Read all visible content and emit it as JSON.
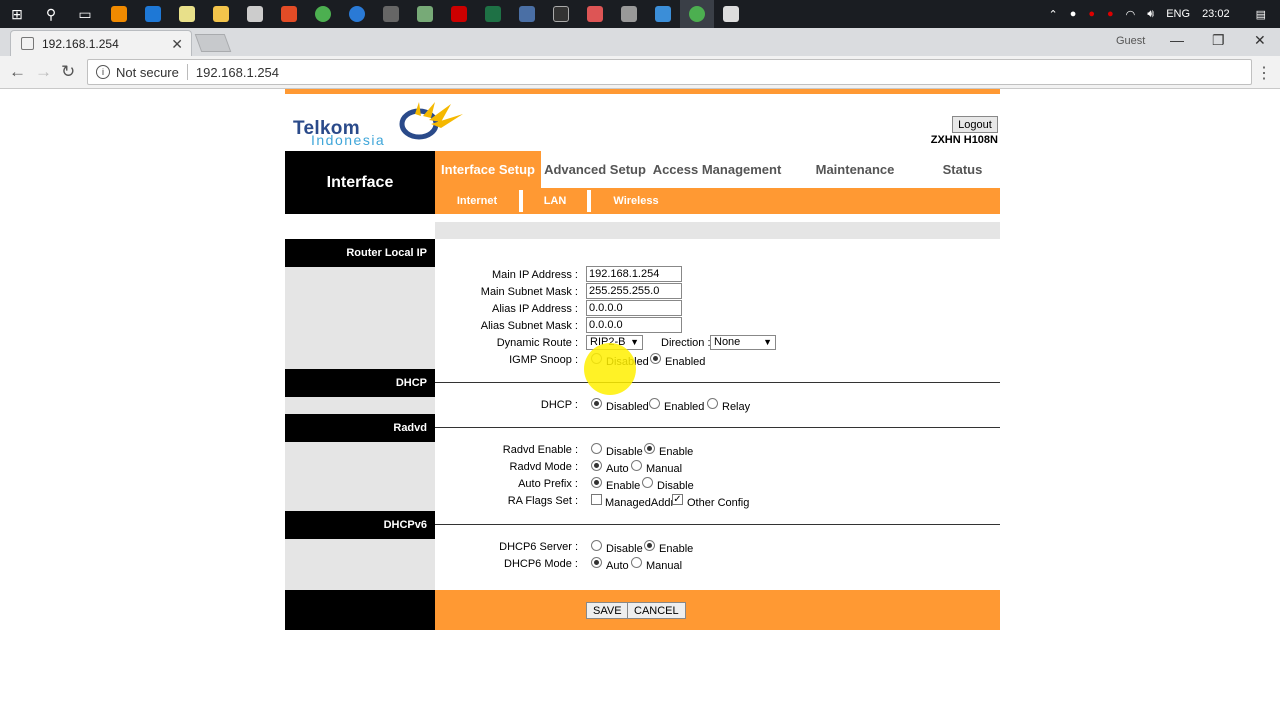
{
  "taskbar": {
    "lang": "ENG",
    "time": "23:02"
  },
  "browser": {
    "tab_title": "192.168.1.254",
    "guest_label": "Guest",
    "security_label": "Not secure",
    "url": "192.168.1.254"
  },
  "router": {
    "logo_line1": "Telkom",
    "logo_line2": "Indonesia",
    "logout_label": "Logout",
    "model": "ZXHN H108N",
    "section_title": "Interface",
    "tabs": [
      {
        "label": "Interface Setup",
        "active": true
      },
      {
        "label": "Advanced Setup"
      },
      {
        "label": "Access Management"
      },
      {
        "label": "Maintenance"
      },
      {
        "label": "Status"
      }
    ],
    "subtabs": [
      "Internet",
      "LAN",
      "Wireless"
    ],
    "router_local_ip": {
      "heading": "Router Local IP",
      "main_ip_label": "Main IP Address :",
      "main_ip_value": "192.168.1.254",
      "main_mask_label": "Main Subnet Mask :",
      "main_mask_value": "255.255.255.0",
      "alias_ip_label": "Alias IP Address :",
      "alias_ip_value": "0.0.0.0",
      "alias_mask_label": "Alias Subnet Mask :",
      "alias_mask_value": "0.0.0.0",
      "dynamic_route_label": "Dynamic Route :",
      "dynamic_route_value": "RIP2-B",
      "direction_label": "Direction :",
      "direction_value": "None",
      "igmp_label": "IGMP Snoop :",
      "igmp_disabled": "Disabled",
      "igmp_enabled": "Enabled"
    },
    "dhcp": {
      "heading": "DHCP",
      "label": "DHCP :",
      "opt_disabled": "Disabled",
      "opt_enabled": "Enabled",
      "opt_relay": "Relay"
    },
    "radvd": {
      "heading": "Radvd",
      "enable_label": "Radvd Enable :",
      "enable_opt1": "Disable",
      "enable_opt2": "Enable",
      "mode_label": "Radvd Mode :",
      "mode_opt1": "Auto",
      "mode_opt2": "Manual",
      "prefix_label": "Auto Prefix :",
      "prefix_opt1": "Enable",
      "prefix_opt2": "Disable",
      "flags_label": "RA Flags Set :",
      "flag1": "ManagedAddr",
      "flag2": "Other Config"
    },
    "dhcpv6": {
      "heading": "DHCPv6",
      "server_label": "DHCP6 Server :",
      "server_opt1": "Disable",
      "server_opt2": "Enable",
      "mode_label": "DHCP6 Mode :",
      "mode_opt1": "Auto",
      "mode_opt2": "Manual"
    },
    "save_label": "SAVE",
    "cancel_label": "CANCEL"
  },
  "colors": {
    "accent": "#ff9933",
    "header": "#000000"
  }
}
